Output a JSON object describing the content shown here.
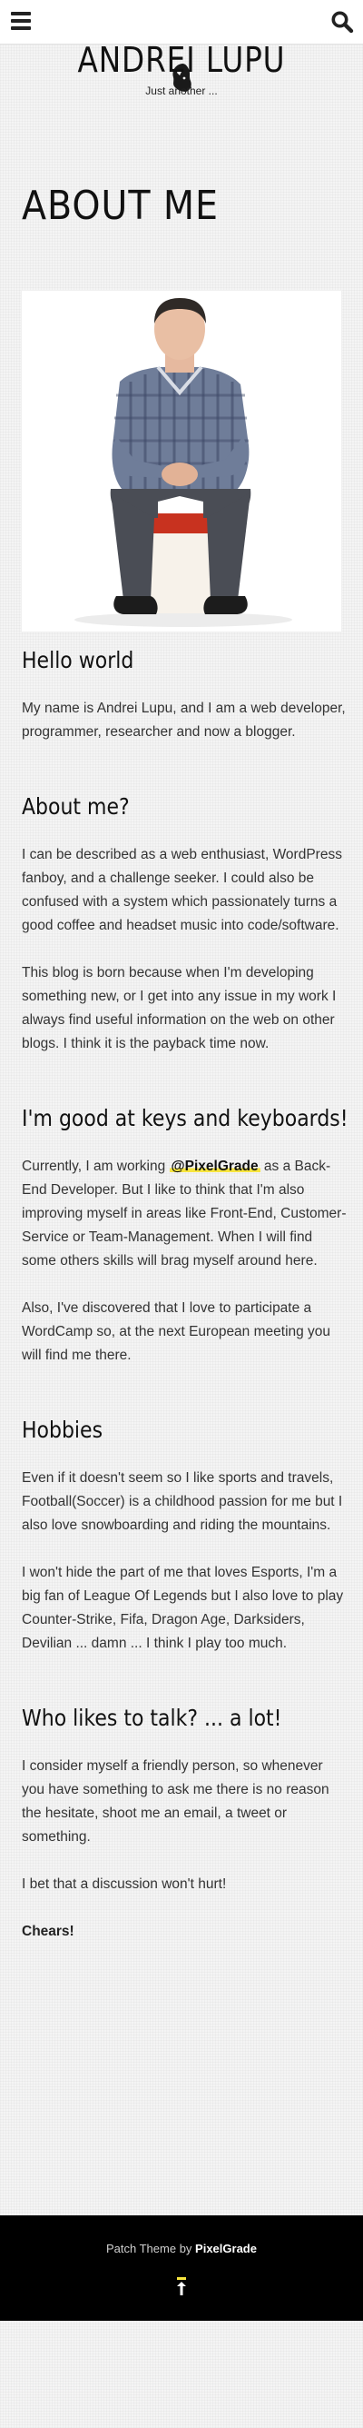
{
  "header": {
    "menu_icon": "hamburger-menu-icon",
    "search_icon": "search-icon"
  },
  "site": {
    "title": "Andrei Lupu",
    "tagline": "Just another ..."
  },
  "page": {
    "title": "ABOUT ME"
  },
  "sections": {
    "hello": {
      "heading": "Hello world",
      "p1": "My name is Andrei Lupu, and I am a web developer, programmer, researcher and now a blogger."
    },
    "about": {
      "heading": "About me?",
      "p1": "I can be described as a web enthusiast, WordPress fanboy, and a challenge seeker. I could also be confused with a system which passionately turns a good coffee and headset music into code/software.",
      "p2": "This blog is born because when I'm developing something new, or I get into any issue in my work I always find useful information on the web on other blogs. I think it is the payback time now."
    },
    "keys": {
      "heading": "I'm good at keys and keyboards!",
      "p1_before": "Currently, I am working ",
      "p1_link": "@PixelGrade",
      "p1_after": " as a Back-End Developer. But I like to think that I'm also improving myself in areas like Front-End, Customer-Service or Team-Management. When I will find some others skills will brag myself around here.",
      "p2": "Also, I've discovered that I love to participate a WordCamp so, at the next European meeting you will find me there."
    },
    "hobbies": {
      "heading": "Hobbies",
      "p1": "Even if it doesn't seem so I like sports and travels, Football(Soccer) is a childhood passion for me but I also love snowboarding and riding the mountains.",
      "p2": "I won't hide the part of me that loves Esports, I'm a big fan of League Of Legends but I also love to play Counter-Strike, Fifa, Dragon Age, Darksiders, Devilian ... damn ... I think I play too much."
    },
    "talk": {
      "heading": "Who likes to talk? ... a lot!",
      "p1": "I consider myself a friendly person, so whenever you have something to ask me there is no reason the hesitate, shoot me an email, a tweet or something.",
      "p2": "I bet that a discussion won't hurt!",
      "p3": "Chears!"
    }
  },
  "footer": {
    "credit_prefix": "Patch Theme by ",
    "credit_link": "PixelGrade",
    "back_to_top_icon": "arrow-up-icon"
  },
  "colors": {
    "highlight": "#f7e53f",
    "footer_bg": "#000000"
  }
}
